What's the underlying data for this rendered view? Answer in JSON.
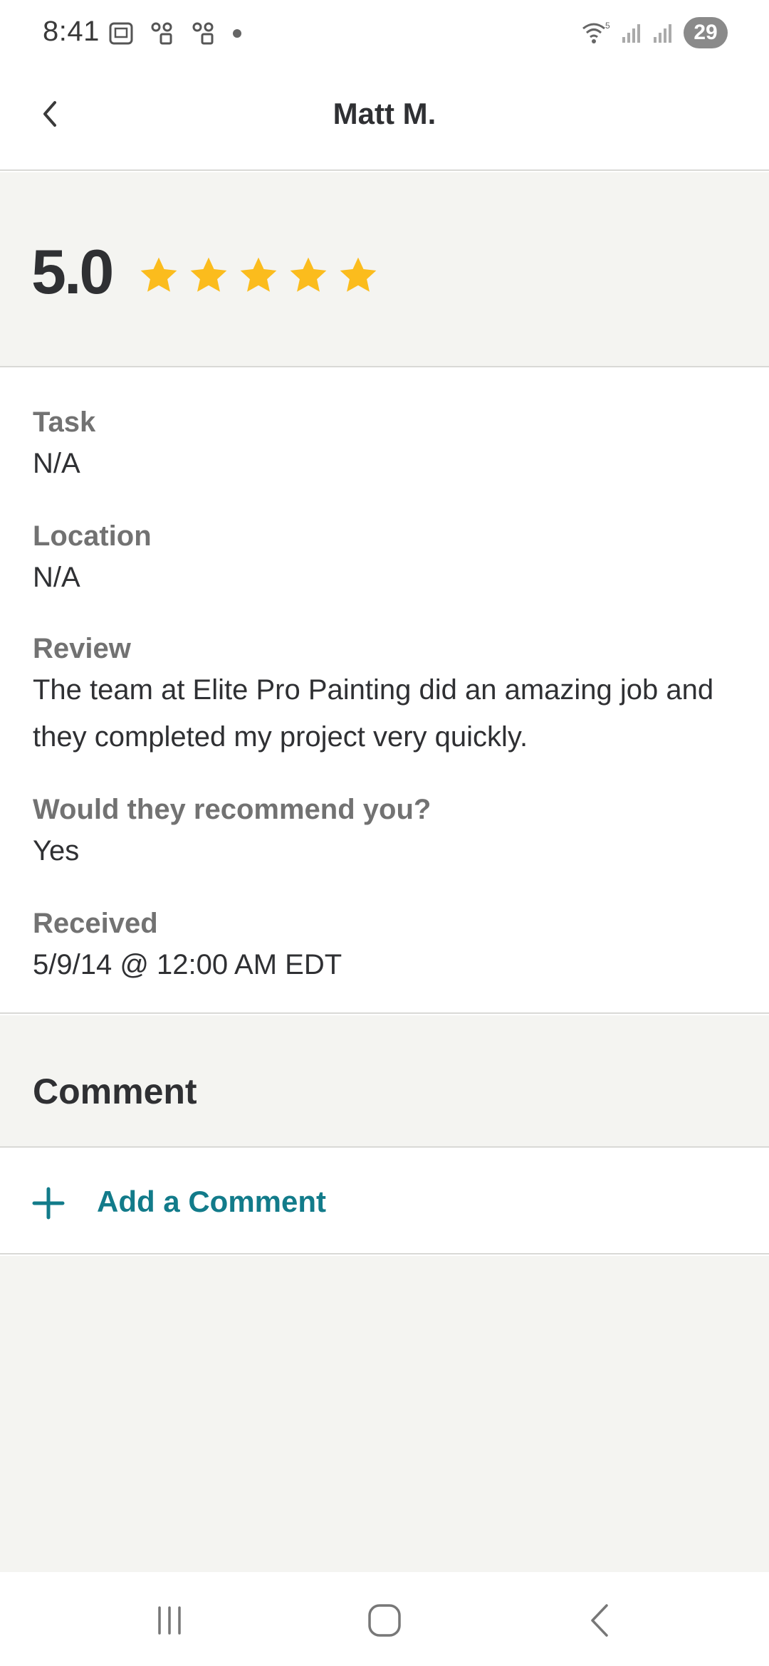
{
  "status_bar": {
    "time": "8:41",
    "battery": "29",
    "left_icons": [
      "screenshot-icon",
      "voicemail-icon",
      "voicemail-icon"
    ],
    "right_icons": [
      "wifi-icon",
      "signal-icon",
      "signal-icon",
      "battery-icon"
    ]
  },
  "app_bar": {
    "title": "Matt M."
  },
  "rating": {
    "value": "5.0",
    "stars": 5,
    "star_color": "#fbbc1d"
  },
  "details": {
    "task_label": "Task",
    "task_value": "N/A",
    "location_label": "Location",
    "location_value": "N/A",
    "review_label": "Review",
    "review_value": "The team at Elite Pro Painting did an amazing job and they completed my project very quickly.",
    "recommend_label": "Would they recommend you?",
    "recommend_value": "Yes",
    "received_label": "Received",
    "received_value": "5/9/14 @ 12:00 AM EDT"
  },
  "comment": {
    "title": "Comment",
    "add_label": "Add a Comment",
    "accent": "#127b8a"
  },
  "nav": [
    "recents-icon",
    "home-icon",
    "back-icon"
  ]
}
